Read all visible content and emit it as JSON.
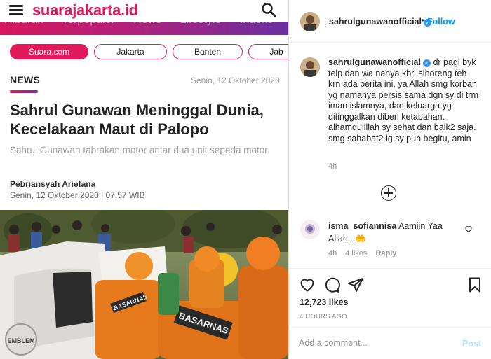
{
  "news": {
    "logo": "suarajakarta.id",
    "category_nav": [
      "Hiburan",
      "Terpopuler",
      "News",
      "Lifestyle",
      "Indeks"
    ],
    "chips": [
      "Suara.com",
      "Jakarta",
      "Banten",
      "Jab"
    ],
    "section": "NEWS",
    "date_top": "Senin, 12 Oktober 2020",
    "headline": "Sahrul Gunawan Meninggal Dunia, Kecelakaan Maut di Palopo",
    "summary": "Sahrul Gunawan tabrakan motor antar dua unit sepeda motor.",
    "author": "Pebriansyah Ariefana",
    "datetime": "Senin, 12 Oktober 2020 | 07:57 WIB",
    "photo_labels": [
      "BASARNAS",
      "BASARNAS"
    ]
  },
  "instagram": {
    "username": "sahrulgunawanofficial",
    "verified_icon": "verified-badge",
    "dot": "•",
    "follow_label": "Follow",
    "caption_user": "sahrulgunawanofficial",
    "caption_text": "dr pagi byk telp dan wa nanya kbr, sihoreng teh krn ada berita ini. ya Allah smg korban yg namanya persis sama dgn sy di trm iman islamnya, dan keluarga yg ditinggalkan diberi ketabahan. alhamdulillah sy sehat dan baik2 saja. smg sahabat2 ig sy pun begitu, amin",
    "caption_time": "4h",
    "comment_user": "isma_sofiannisa",
    "comment_text": "Aamiin Yaa Allah...",
    "comment_emoji": "🤲",
    "comment_time": "4h",
    "comment_likes": "4 likes",
    "comment_reply": "Reply",
    "likes": "12,723 likes",
    "posted_ago": "4 HOURS AGO",
    "comment_placeholder": "Add a comment...",
    "post_label": "Post"
  }
}
